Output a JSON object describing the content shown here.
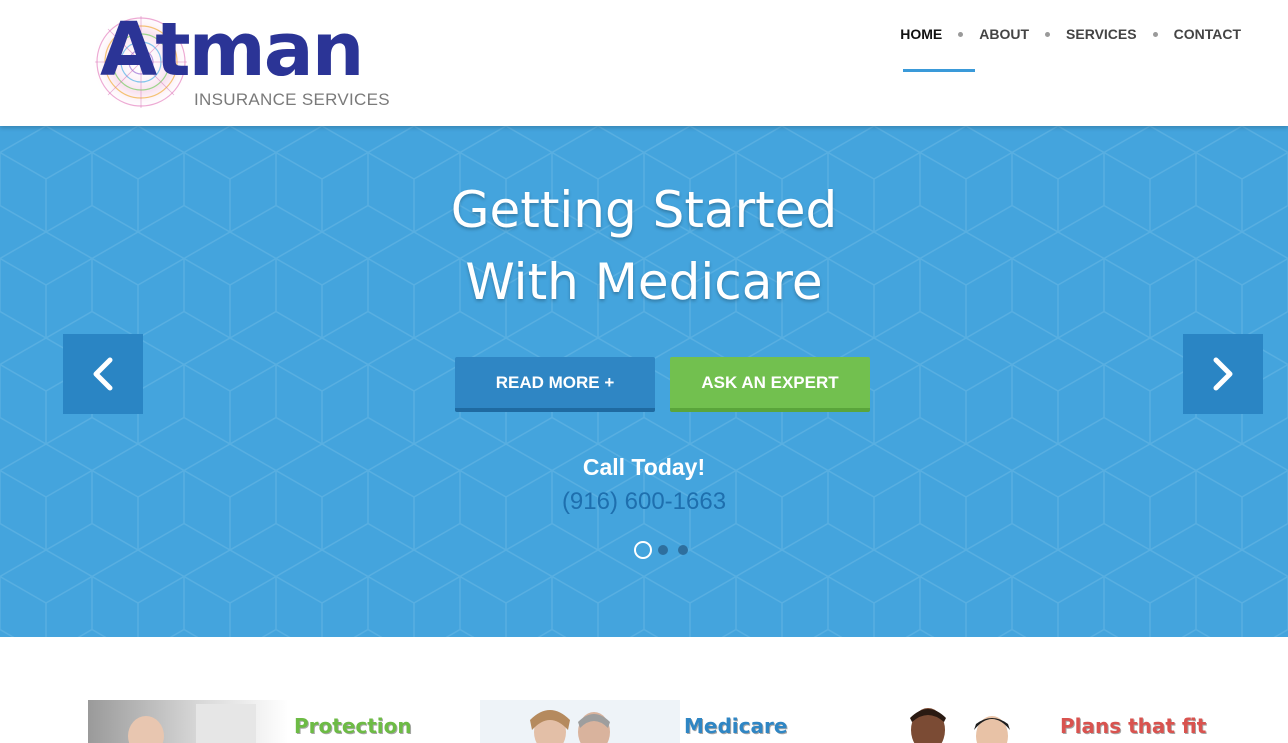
{
  "logo": {
    "word": "Atman",
    "subtitle": "INSURANCE SERVICES"
  },
  "nav": {
    "items": [
      {
        "label": "HOME",
        "active": true
      },
      {
        "label": "ABOUT",
        "active": false
      },
      {
        "label": "SERVICES",
        "active": false
      },
      {
        "label": "CONTACT",
        "active": false
      }
    ]
  },
  "hero": {
    "title_line1": "Getting Started",
    "title_line2": "With Medicare",
    "read_more_label": "READ MORE +",
    "ask_expert_label": "ASK AN EXPERT",
    "call_label": "Call Today!",
    "phone": "(916) 600-1663",
    "slide_count": 3,
    "active_slide": 1,
    "background_color": "#44a4dd",
    "arrow_left_icon": "chevron-left-icon",
    "arrow_right_icon": "chevron-right-icon"
  },
  "teasers": [
    {
      "title": "Protection",
      "color": "#6dbb45"
    },
    {
      "title": "Medicare",
      "color": "#2f86c4"
    },
    {
      "title": "Plans that fit",
      "color": "#d9534f"
    }
  ]
}
